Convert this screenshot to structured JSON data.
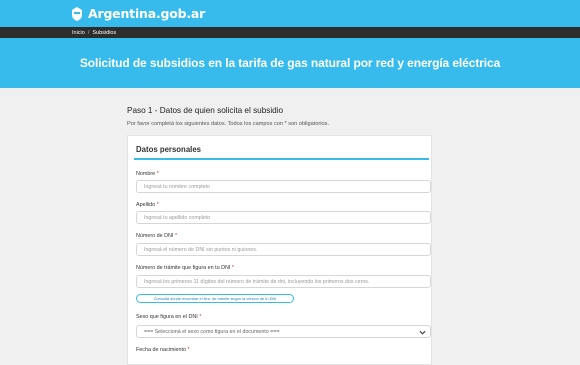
{
  "header": {
    "brand": "Argentina.gob.ar"
  },
  "breadcrumb": {
    "home": "Inicio",
    "separator": "/",
    "current": "Subsidios"
  },
  "hero": {
    "title": "Solicitud de subsidios en la tarifa de gas natural por red y energía eléctrica"
  },
  "step": {
    "title": "Paso 1 - Datos de quien solicita el subsidio",
    "description": "Por favor completá los siguientes datos. Todos los campos con * son obligatorios."
  },
  "section": {
    "title": "Datos personales",
    "required_mark": "*",
    "fields": {
      "nombre": {
        "label": "Nombre",
        "placeholder": "Ingresá tu nombre completo"
      },
      "apellido": {
        "label": "Apellido",
        "placeholder": "Ingresá tu apellido completo"
      },
      "dni": {
        "label": "Número de DNI",
        "placeholder": "Ingresá el número de DNI sin puntos ni guiones."
      },
      "tramite": {
        "label": "Número de trámite que figura en tu DNI",
        "placeholder": "Ingresá los primeros 11 dígitos del número de trámite de dni, incluyendo los primeros dos ceros."
      },
      "tramite_help": "Consultá dónde encontrar el Nro. de trámite según la versión de tu DNI",
      "sexo": {
        "label": "Sexo que figura en el DNI",
        "selected": "=== Seleccioná el sexo como figura en el documento ==="
      },
      "nacimiento": {
        "label": "Fecha de nacimiento"
      }
    }
  },
  "colors": {
    "primary": "#37bbed",
    "dark": "#2d2d2d",
    "required": "#c0392b"
  },
  "icons": {
    "logo": "argentina-shield-icon",
    "select": "chevron-down-icon"
  }
}
